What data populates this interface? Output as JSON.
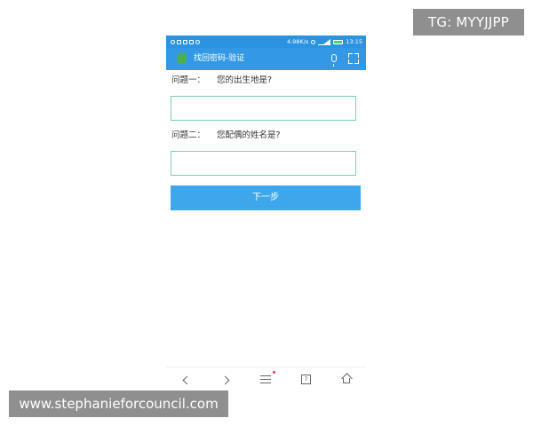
{
  "watermark_top": "TG: MYYJJPP",
  "watermark_bottom": "www.stephanieforcouncil.com",
  "status_bar": {
    "speed": "4.98K/s",
    "time": "13:15"
  },
  "app_bar": {
    "title": "找回密码-验证",
    "icons": [
      "app-logo-icon",
      "microphone-icon",
      "scan-icon"
    ]
  },
  "form": {
    "question1_label": "问题一：",
    "question1_text": "您的出生地是?",
    "answer1_value": "",
    "question2_label": "问题二：",
    "question2_text": "您配偶的姓名是?",
    "answer2_value": "",
    "next_button": "下一步"
  },
  "bottom_nav": {
    "tabs_count": "7",
    "icons": [
      "back-icon",
      "forward-icon",
      "menu-icon",
      "tabs-icon",
      "home-icon"
    ]
  },
  "colors": {
    "status_bar": "#2b93e0",
    "app_bar": "#3399e6",
    "button": "#3ea7eb",
    "input_border": "#7fcfa9"
  }
}
